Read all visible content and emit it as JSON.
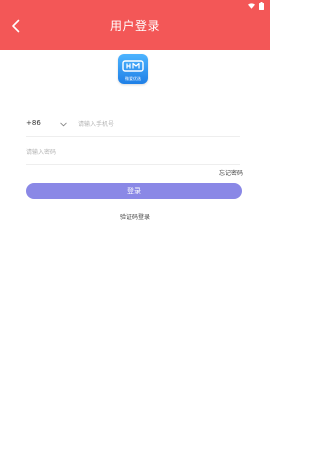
{
  "header": {
    "title": "用户登录",
    "back_icon": "chevron-left-icon",
    "background_color": "#f35757"
  },
  "status_bar": {
    "icons": [
      "wifi-icon",
      "battery-icon"
    ]
  },
  "logo": {
    "caption": "微爱优选",
    "gradient": [
      "#4db4ff",
      "#1f7fe6"
    ]
  },
  "form": {
    "country_code": "+86",
    "phone_placeholder": "请输入手机号",
    "password_placeholder": "请输入密码",
    "forgot_password_label": "忘记密码",
    "login_button_label": "登录",
    "login_button_color": "#8a88e6",
    "code_login_label": "验证码登录"
  }
}
